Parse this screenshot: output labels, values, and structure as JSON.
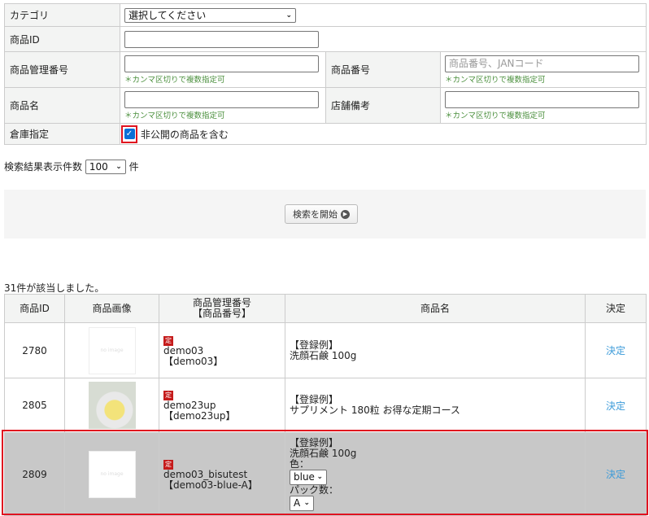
{
  "form": {
    "category_label": "カテゴリ",
    "category_value": "選択してください",
    "product_id_label": "商品ID",
    "mgmt_no_label": "商品管理番号",
    "product_no_label": "商品番号",
    "product_no_placeholder": "商品番号、JANコード",
    "name_label": "商品名",
    "store_note_label": "店舗備考",
    "note": "＊カンマ区切りで複数指定可",
    "warehouse_label": "倉庫指定",
    "include_private_label": "非公開の商品を含む",
    "include_private_checked": true
  },
  "results_per_page": {
    "label": "検索結果表示件数",
    "value": "100",
    "unit": "件"
  },
  "search_button": "検索を開始",
  "found_text": "31件が該当しました。",
  "table": {
    "headers": [
      "商品ID",
      "商品画像",
      "商品管理番号",
      "【商品番号】",
      "商品名",
      "決定"
    ],
    "rows": [
      {
        "id": "2780",
        "image": "no image",
        "tag": "定",
        "mgmt": "demo03",
        "code": "【demo03】",
        "name1": "【登録例】",
        "name2": "洗顔石鹸 100g",
        "action": "決定"
      },
      {
        "id": "2805",
        "image": "photo",
        "tag": "定",
        "mgmt": "demo23up",
        "code": "【demo23up】",
        "name1": "【登録例】",
        "name2": "サプリメント 180粒 お得な定期コース",
        "action": "決定"
      },
      {
        "id": "2809",
        "image": "no image",
        "tag": "定",
        "mgmt": "demo03_bisutest",
        "code": "【demo03-blue-A】",
        "name1": "【登録例】",
        "name2": "洗顔石鹸 100g",
        "color_label": "色：",
        "color_value": "blue",
        "pack_label": "パック数：",
        "pack_value": "A",
        "action": "決定"
      }
    ]
  }
}
